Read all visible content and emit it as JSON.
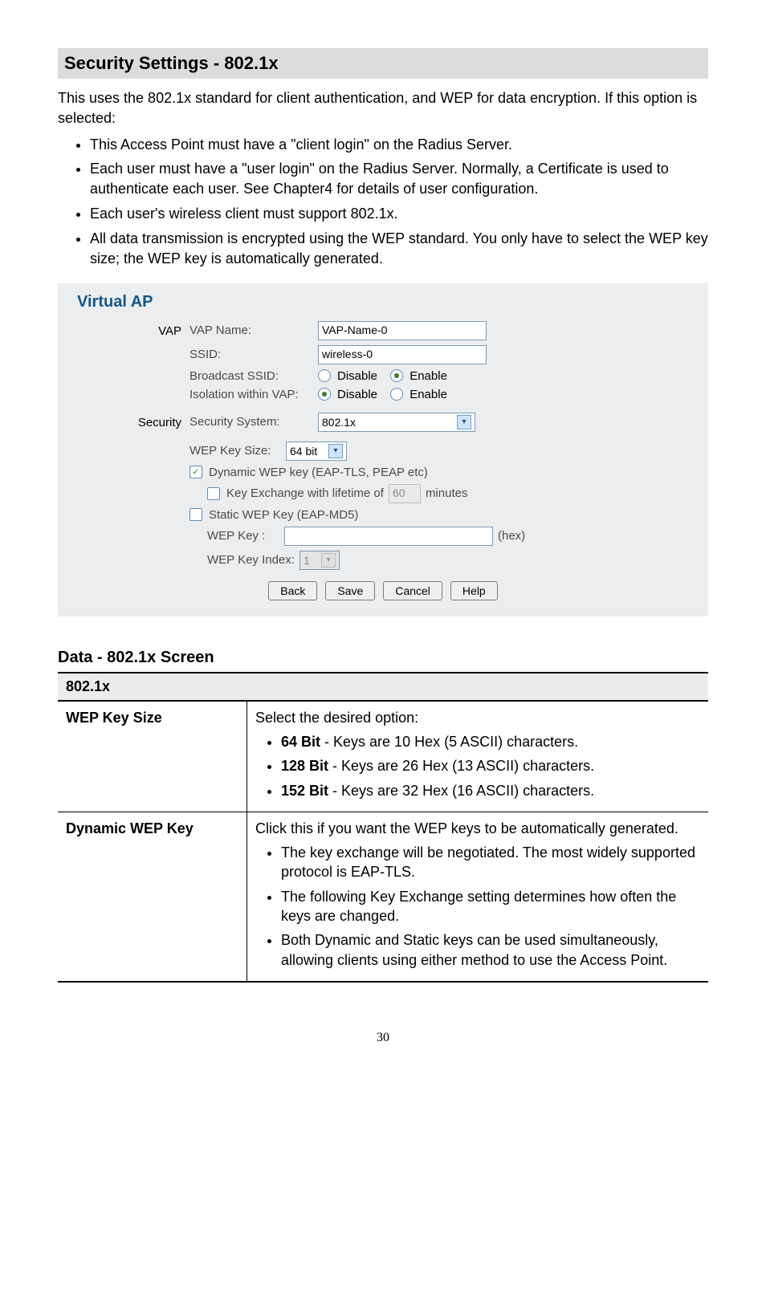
{
  "heading": "Security Settings - 802.1x",
  "intro": "This uses the 802.1x standard for client authentication, and WEP for data encryption. If this option is selected:",
  "intro_bullets": [
    "This Access Point must have a \"client login\" on the Radius Server.",
    "Each user must have a \"user login\" on the Radius Server. Normally, a Certificate is used to authenticate each user. See Chapter4 for details of user configuration.",
    "Each user's wireless client must support 802.1x.",
    "All data transmission is encrypted using the WEP standard. You only have to select the WEP key size; the WEP key is automatically generated."
  ],
  "screenshot": {
    "title": "Virtual AP",
    "group_vap": "VAP",
    "vap_name_label": "VAP Name:",
    "vap_name_value": "VAP-Name-0",
    "ssid_label": "SSID:",
    "ssid_value": "wireless-0",
    "broadcast_label": "Broadcast SSID:",
    "isolation_label": "Isolation within VAP:",
    "disable": "Disable",
    "enable": "Enable",
    "group_security": "Security",
    "security_system_label": "Security System:",
    "security_system_value": "802.1x",
    "wep_key_size_label": "WEP Key Size:",
    "wep_key_size_value": "64 bit",
    "dynamic_label": "Dynamic WEP key (EAP-TLS, PEAP etc)",
    "key_exchange_prefix": "Key Exchange with lifetime of",
    "key_exchange_value": "60",
    "key_exchange_suffix": "minutes",
    "static_label": "Static WEP Key (EAP-MD5)",
    "wep_key_label": "WEP Key :",
    "wep_key_suffix": "(hex)",
    "wep_key_index_label": "WEP Key Index:",
    "wep_key_index_value": "1",
    "btn_back": "Back",
    "btn_save": "Save",
    "btn_cancel": "Cancel",
    "btn_help": "Help"
  },
  "subheading": "Data - 802.1x Screen",
  "table": {
    "header": "802.1x",
    "rows": [
      {
        "name": "WEP Key Size",
        "lead": "Select the desired option:",
        "items": [
          {
            "b": "64 Bit",
            "rest": "  - Keys are 10 Hex (5 ASCII) characters."
          },
          {
            "b": "128 Bit",
            "rest": " - Keys are 26 Hex (13 ASCII) characters."
          },
          {
            "b": "152 Bit",
            "rest": " - Keys are 32 Hex (16 ASCII) characters."
          }
        ]
      },
      {
        "name": "Dynamic WEP Key",
        "lead": "Click this if you want the WEP keys to be automatically generated.",
        "items": [
          {
            "b": "",
            "rest": "The key exchange will be negotiated. The most widely supported protocol is EAP-TLS."
          },
          {
            "b": "",
            "rest": "The following Key Exchange setting determines how often the keys are changed."
          },
          {
            "b": "",
            "rest": "Both Dynamic and Static keys can be used simultaneously, allowing clients using either method to use the Access Point."
          }
        ]
      }
    ]
  },
  "page_number": "30"
}
